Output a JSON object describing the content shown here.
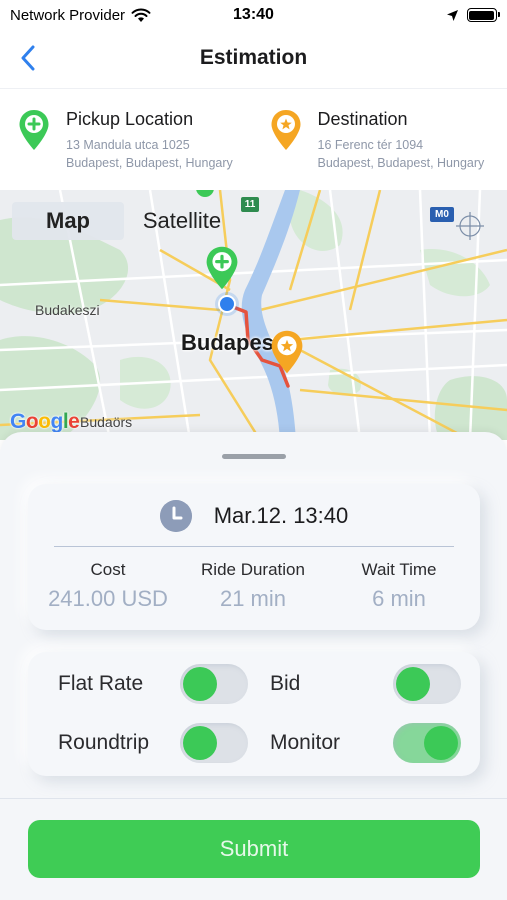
{
  "status_bar": {
    "carrier": "Network Provider",
    "time": "13:40"
  },
  "nav": {
    "title": "Estimation"
  },
  "pickup": {
    "title": "Pickup Location",
    "line1": "13 Mandula utca 1025",
    "line2": "Budapest, Budapest, Hungary",
    "color": "#3cc957"
  },
  "destination": {
    "title": "Destination",
    "line1": "16 Ferenc tér 1094",
    "line2": "Budapest, Budapest, Hungary",
    "color": "#f5a623"
  },
  "map": {
    "tabs": [
      "Map",
      "Satellite"
    ],
    "active_tab": "Map",
    "city_label": "Budapest",
    "town_labels": [
      "Budakeszi",
      "Budaörs"
    ],
    "road_badges": [
      "11",
      "M0"
    ],
    "attribution": "Google"
  },
  "estimate": {
    "datetime": "Mar.12. 13:40",
    "cost_label": "Cost",
    "cost_value": "241.00 USD",
    "duration_label": "Ride Duration",
    "duration_value": "21 min",
    "wait_label": "Wait Time",
    "wait_value": "6 min"
  },
  "options": {
    "flat_rate": {
      "label": "Flat Rate",
      "state": "off"
    },
    "bid": {
      "label": "Bid",
      "state": "off"
    },
    "roundtrip": {
      "label": "Roundtrip",
      "state": "off"
    },
    "monitor": {
      "label": "Monitor",
      "state": "on"
    }
  },
  "submit": {
    "label": "Submit"
  },
  "colors": {
    "accent_green": "#3fcc55",
    "route": "#e5533d",
    "stat_value": "#a2afc4",
    "back_chevron": "#2f80ed"
  }
}
